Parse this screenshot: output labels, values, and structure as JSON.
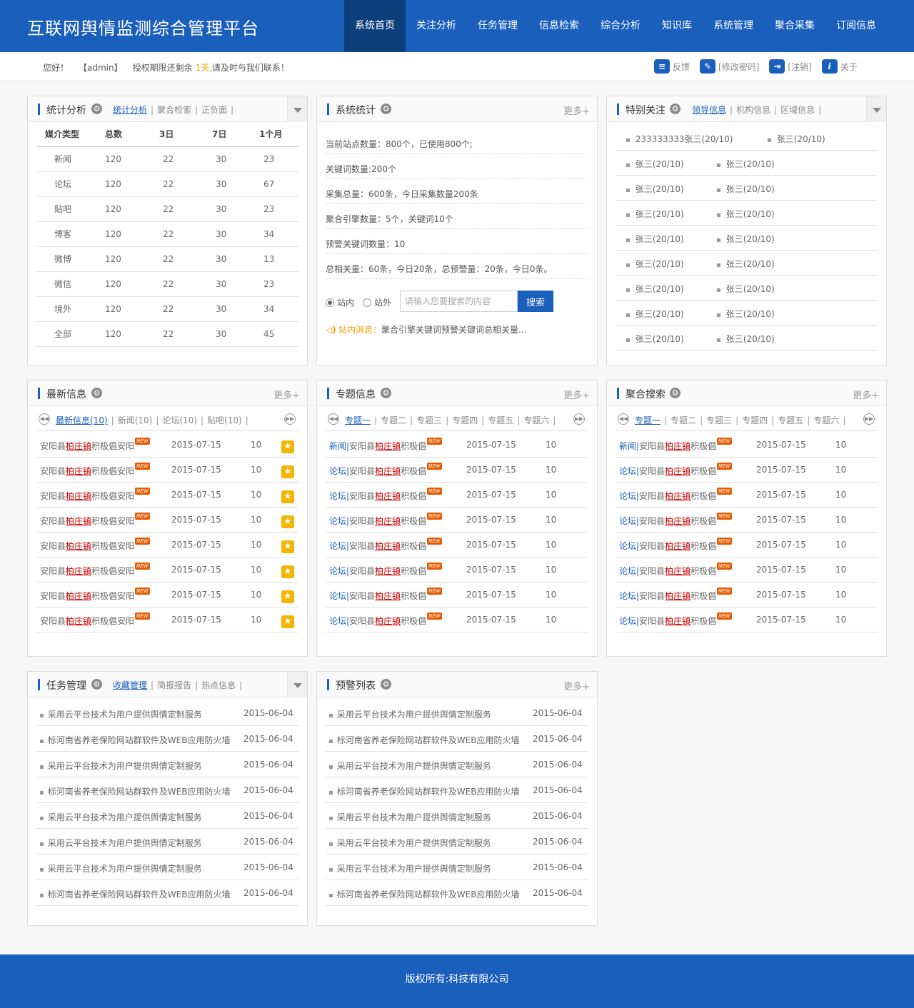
{
  "header": {
    "title": "互联网舆情监测综合管理平台",
    "nav": [
      "系统首页",
      "关注分析",
      "任务管理",
      "信息检索",
      "综合分析",
      "知识库",
      "系统管理",
      "聚合采集",
      "订阅信息"
    ]
  },
  "subbar": {
    "hello": "您好！",
    "user": "【admin】",
    "license_prefix": "授权期限还剩余",
    "license_days": "1天,",
    "license_suffix": "请及时与我们联系！",
    "tools": {
      "feedback": "反馈",
      "password": "[修改密码]",
      "logout": "[注销]",
      "about": "关于"
    }
  },
  "stats_panel": {
    "title": "统计分析",
    "tabs": [
      "统计分析",
      "聚合检索",
      "正负面"
    ],
    "columns": [
      "媒介类型",
      "总数",
      "3日",
      "7日",
      "1个月"
    ],
    "rows": [
      [
        "新闻",
        "120",
        "22",
        "30",
        "23"
      ],
      [
        "论坛",
        "120",
        "22",
        "30",
        "67"
      ],
      [
        "贴吧",
        "120",
        "22",
        "30",
        "23"
      ],
      [
        "博客",
        "120",
        "22",
        "30",
        "34"
      ],
      [
        "微博",
        "120",
        "22",
        "30",
        "13"
      ],
      [
        "微信",
        "120",
        "22",
        "30",
        "23"
      ],
      [
        "境外",
        "120",
        "22",
        "30",
        "34"
      ],
      [
        "全部",
        "120",
        "22",
        "30",
        "45"
      ]
    ]
  },
  "system_panel": {
    "title": "系统统计",
    "more": "更多+",
    "lines": [
      "当前站点数量：800个，已使用800个;",
      "关键词数量:200个",
      "采集总量：600条，今日采集数量200条",
      "聚合引擎数量：5个，关键词10个",
      "预警关键词数量：10",
      "总相关量：60条，今日20条，总预警量：20条，今日0条。"
    ],
    "radio_in": "站内",
    "radio_out": "站外",
    "search_placeholder": "请输入您要搜索的内容",
    "search_button": "搜索",
    "notice_label": "站内消息：",
    "notice_text": "聚合引擎关键词预警关键词总相关量..."
  },
  "attention_panel": {
    "title": "特别关注",
    "tabs": [
      "领导信息",
      "机构信息",
      "区域信息"
    ],
    "rows": [
      [
        "233333333张三(20/10)",
        "张三(20/10)"
      ],
      [
        "张三(20/10)",
        "张三(20/10)"
      ],
      [
        "张三(20/10)",
        "张三(20/10)"
      ],
      [
        "张三(20/10)",
        "张三(20/10)"
      ],
      [
        "张三(20/10)",
        "张三(20/10)"
      ],
      [
        "张三(20/10)",
        "张三(20/10)"
      ],
      [
        "张三(20/10)",
        "张三(20/10)"
      ],
      [
        "张三(20/10)",
        "张三(20/10)"
      ],
      [
        "张三(20/10)",
        "张三(20/10)"
      ]
    ]
  },
  "latest_panel": {
    "title": "最新信息",
    "more": "更多+",
    "tabs": [
      "最新信息(10)",
      "新闻(10)",
      "论坛(10)",
      "贴吧(10)"
    ],
    "items": [
      {
        "pre": "安阳县",
        "hl": "柏庄镇",
        "post": "积极倡安阳",
        "badge": "NEW",
        "date": "2015-07-15",
        "num": "10"
      },
      {
        "pre": "安阳县",
        "hl": "柏庄镇",
        "post": "积极倡安阳",
        "badge": "NEW",
        "date": "2015-07-15",
        "num": "10"
      },
      {
        "pre": "安阳县",
        "hl": "柏庄镇",
        "post": "积极倡安阳",
        "badge": "NEW",
        "date": "2015-07-15",
        "num": "10"
      },
      {
        "pre": "安阳县",
        "hl": "柏庄镇",
        "post": "积极倡安阳",
        "badge": "NEW",
        "date": "2015-07-15",
        "num": "10"
      },
      {
        "pre": "安阳县",
        "hl": "柏庄镇",
        "post": "积极倡安阳",
        "badge": "NEW",
        "date": "2015-07-15",
        "num": "10"
      },
      {
        "pre": "安阳县",
        "hl": "柏庄镇",
        "post": "积极倡安阳",
        "badge": "NEW",
        "date": "2015-07-15",
        "num": "10"
      },
      {
        "pre": "安阳县",
        "hl": "柏庄镇",
        "post": "积极倡安阳",
        "badge": "NEW",
        "date": "2015-07-15",
        "num": "10"
      },
      {
        "pre": "安阳县",
        "hl": "柏庄镇",
        "post": "积极倡安阳",
        "badge": "NEW",
        "date": "2015-07-15",
        "num": "10"
      }
    ]
  },
  "topic_panel": {
    "title": "专题信息",
    "more": "更多+",
    "tabs": [
      "专题一",
      "专题二",
      "专题三",
      "专题四",
      "专题五",
      "专题六"
    ],
    "items": [
      {
        "cat": "新闻|",
        "pre": "安阳县",
        "hl": "柏庄镇",
        "post": "积极倡",
        "badge": "NEW",
        "date": "2015-07-15",
        "num": "10"
      },
      {
        "cat": "论坛|",
        "pre": "安阳县",
        "hl": "柏庄镇",
        "post": "积极倡",
        "badge": "NEW",
        "date": "2015-07-15",
        "num": "10"
      },
      {
        "cat": "论坛|",
        "pre": "安阳县",
        "hl": "柏庄镇",
        "post": "积极倡",
        "badge": "NEW",
        "date": "2015-07-15",
        "num": "10"
      },
      {
        "cat": "论坛|",
        "pre": "安阳县",
        "hl": "柏庄镇",
        "post": "积极倡",
        "badge": "NEW",
        "date": "2015-07-15",
        "num": "10"
      },
      {
        "cat": "论坛|",
        "pre": "安阳县",
        "hl": "柏庄镇",
        "post": "积极倡",
        "badge": "NEW",
        "date": "2015-07-15",
        "num": "10"
      },
      {
        "cat": "论坛|",
        "pre": "安阳县",
        "hl": "柏庄镇",
        "post": "积极倡",
        "badge": "NEW",
        "date": "2015-07-15",
        "num": "10"
      },
      {
        "cat": "论坛|",
        "pre": "安阳县",
        "hl": "柏庄镇",
        "post": "积极倡",
        "badge": "NEW",
        "date": "2015-07-15",
        "num": "10"
      },
      {
        "cat": "论坛|",
        "pre": "安阳县",
        "hl": "柏庄镇",
        "post": "积极倡",
        "badge": "NEW",
        "date": "2015-07-15",
        "num": "10"
      }
    ]
  },
  "aggregate_panel": {
    "title": "聚合搜索",
    "more": "更多+",
    "tabs": [
      "专题一",
      "专题二",
      "专题三",
      "专题四",
      "专题五",
      "专题六"
    ],
    "items": [
      {
        "cat": "新闻|",
        "pre": "安阳县",
        "hl": "柏庄镇",
        "post": "积极倡",
        "badge": "NEW",
        "date": "2015-07-15",
        "num": "10"
      },
      {
        "cat": "论坛|",
        "pre": "安阳县",
        "hl": "柏庄镇",
        "post": "积极倡",
        "badge": "NEW",
        "date": "2015-07-15",
        "num": "10"
      },
      {
        "cat": "论坛|",
        "pre": "安阳县",
        "hl": "柏庄镇",
        "post": "积极倡",
        "badge": "NEW",
        "date": "2015-07-15",
        "num": "10"
      },
      {
        "cat": "论坛|",
        "pre": "安阳县",
        "hl": "柏庄镇",
        "post": "积极倡",
        "badge": "NEW",
        "date": "2015-07-15",
        "num": "10"
      },
      {
        "cat": "论坛|",
        "pre": "安阳县",
        "hl": "柏庄镇",
        "post": "积极倡",
        "badge": "NEW",
        "date": "2015-07-15",
        "num": "10"
      },
      {
        "cat": "论坛|",
        "pre": "安阳县",
        "hl": "柏庄镇",
        "post": "积极倡",
        "badge": "NEW",
        "date": "2015-07-15",
        "num": "10"
      },
      {
        "cat": "论坛|",
        "pre": "安阳县",
        "hl": "柏庄镇",
        "post": "积极倡",
        "badge": "NEW",
        "date": "2015-07-15",
        "num": "10"
      },
      {
        "cat": "论坛|",
        "pre": "安阳县",
        "hl": "柏庄镇",
        "post": "积极倡",
        "badge": "NEW",
        "date": "2015-07-15",
        "num": "10"
      }
    ]
  },
  "task_panel": {
    "title": "任务管理",
    "tabs": [
      "收藏管理",
      "简报报告",
      "热点信息"
    ],
    "items": [
      {
        "title": "采用云平台技术为用户提供舆情定制服务",
        "date": "2015-06-04"
      },
      {
        "title": "标河南省养老保险网站群软件及WEB应用防火墙",
        "date": "2015-06-04"
      },
      {
        "title": "采用云平台技术为用户提供舆情定制服务",
        "date": "2015-06-04"
      },
      {
        "title": "标河南省养老保险网站群软件及WEB应用防火墙",
        "date": "2015-06-04"
      },
      {
        "title": "采用云平台技术为用户提供舆情定制服务",
        "date": "2015-06-04"
      },
      {
        "title": "采用云平台技术为用户提供舆情定制服务",
        "date": "2015-06-04"
      },
      {
        "title": "采用云平台技术为用户提供舆情定制服务",
        "date": "2015-06-04"
      },
      {
        "title": "标河南省养老保险网站群软件及WEB应用防火墙",
        "date": "2015-06-04"
      }
    ]
  },
  "alert_panel": {
    "title": "预警列表",
    "more": "更多+",
    "items": [
      {
        "title": "采用云平台技术为用户提供舆情定制服务",
        "date": "2015-06-04"
      },
      {
        "title": "标河南省养老保险网站群软件及WEB应用防火墙",
        "date": "2015-06-04"
      },
      {
        "title": "采用云平台技术为用户提供舆情定制服务",
        "date": "2015-06-04"
      },
      {
        "title": "标河南省养老保险网站群软件及WEB应用防火墙",
        "date": "2015-06-04"
      },
      {
        "title": "采用云平台技术为用户提供舆情定制服务",
        "date": "2015-06-04"
      },
      {
        "title": "采用云平台技术为用户提供舆情定制服务",
        "date": "2015-06-04"
      },
      {
        "title": "采用云平台技术为用户提供舆情定制服务",
        "date": "2015-06-04"
      },
      {
        "title": "标河南省养老保险网站群软件及WEB应用防火墙",
        "date": "2015-06-04"
      }
    ]
  },
  "footer": {
    "copyright": "版权所有:科技有限公司"
  }
}
